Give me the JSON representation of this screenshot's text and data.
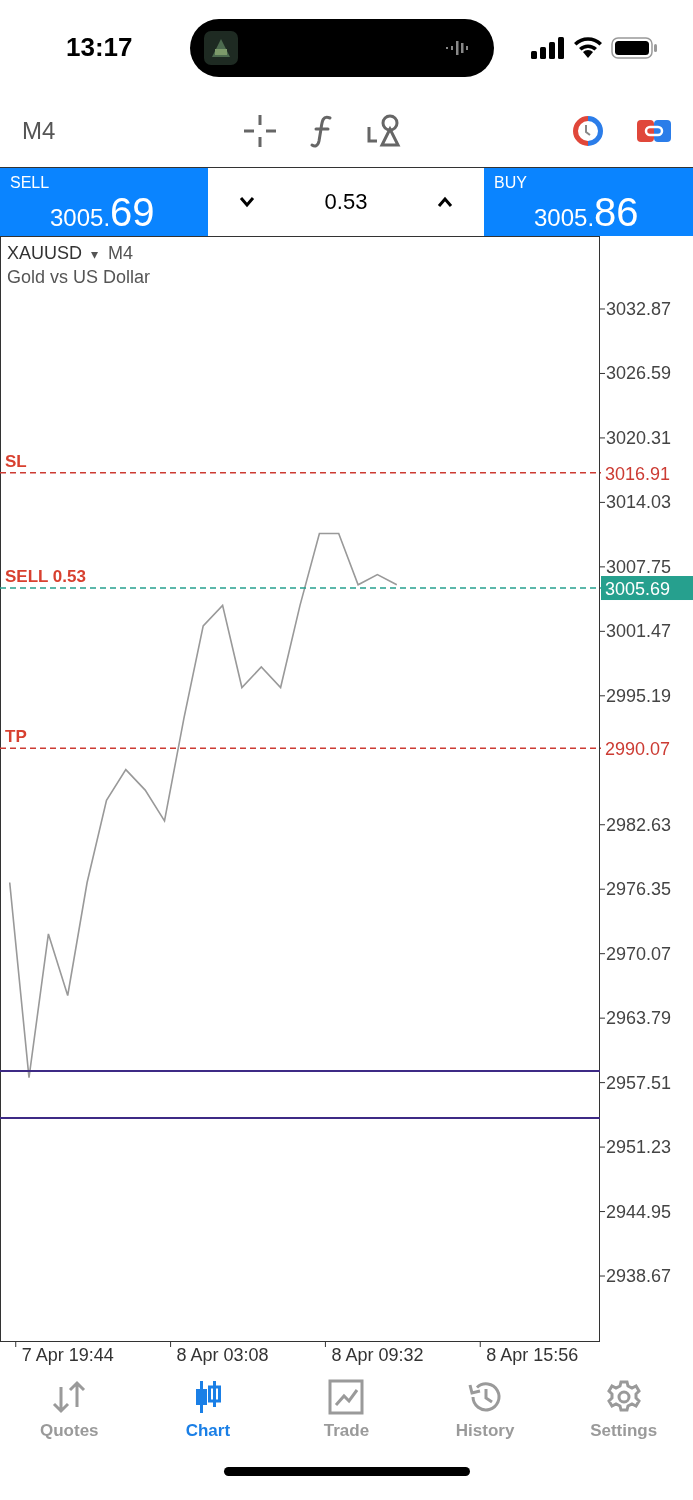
{
  "status_bar": {
    "time": "13:17"
  },
  "toolbar": {
    "timeframe": "M4"
  },
  "trade_panel": {
    "sell": {
      "label": "SELL",
      "price_main": "3005.",
      "price_big": "69"
    },
    "volume": "0.53",
    "buy": {
      "label": "BUY",
      "price_main": "3005.",
      "price_big": "86"
    }
  },
  "chart": {
    "dropdown": "▾",
    "timeframe": "M4",
    "description": "Gold vs US Dollar",
    "chart_data": {
      "type": "line",
      "categories": [
        null,
        null,
        null,
        "7 Apr 19:44",
        null,
        null,
        null,
        null,
        null,
        null,
        null,
        "8 Apr 03:08",
        null,
        null,
        null,
        null,
        null,
        null,
        null,
        "8 Apr 09:32",
        null,
        null,
        null,
        null,
        null,
        null,
        null,
        "8 Apr 15:56",
        null,
        null,
        null
      ],
      "series": [
        {
          "name": "XAUUSD",
          "color": "#999999",
          "values": [
            2977,
            2958,
            2972,
            2966,
            2977,
            2985,
            2988,
            2986,
            2983,
            2993,
            3002,
            3004,
            2996,
            2998,
            2996,
            3004,
            3011,
            3011,
            3006,
            3007,
            3006,
            null,
            null,
            null,
            null,
            null,
            null,
            null,
            null,
            null,
            null
          ]
        }
      ],
      "ylim": [
        2932.34,
        3039.98
      ],
      "yticks": [
        3032.87,
        3026.59,
        3020.31,
        3014.03,
        3007.75,
        3001.47,
        2995.19,
        2982.63,
        2976.35,
        2970.07,
        2963.79,
        2957.51,
        2951.23,
        2944.95,
        2938.67
      ]
    },
    "order_levels": [
      {
        "label": "SL",
        "price": "3016.91",
        "color": "#cc3b33",
        "highlighted": false
      },
      {
        "label": "SELL 0.53",
        "price": "3005.69",
        "color": "#26a08e",
        "highlighted": true
      },
      {
        "label": "TP",
        "price": "2990.07",
        "color": "#cc3b33",
        "highlighted": false
      }
    ]
  },
  "nav": [
    {
      "label": "Quotes",
      "selected": false
    },
    {
      "label": "Chart",
      "selected": true
    },
    {
      "label": "Trade",
      "selected": false
    },
    {
      "label": "History",
      "selected": false
    },
    {
      "label": "Settings",
      "selected": false
    }
  ]
}
